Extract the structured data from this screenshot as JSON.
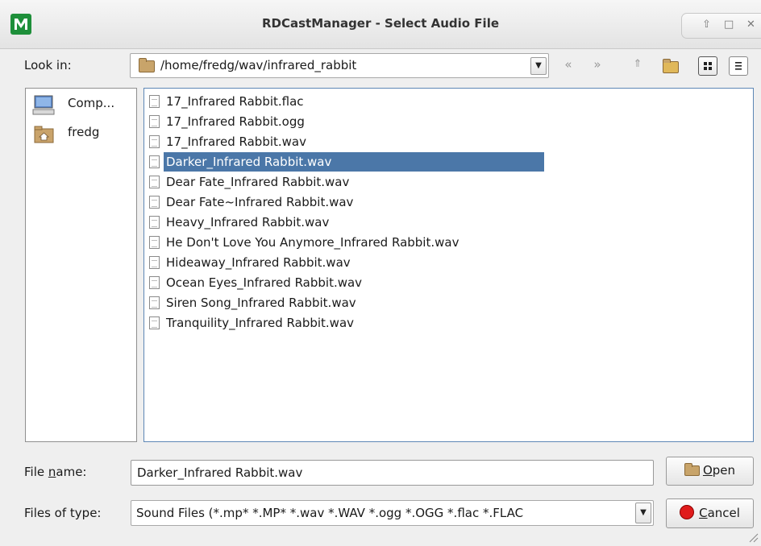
{
  "window": {
    "title": "RDCastManager - Select Audio File",
    "controls": [
      "⇧",
      "□",
      "✕"
    ]
  },
  "look_in": {
    "label": "Look in:",
    "path": "/home/fredg/wav/infrared_rabbit",
    "toolbar_icons": [
      "back-icon",
      "forward-icon",
      "parent-directory-icon",
      "new-folder-icon",
      "list-view-icon",
      "detail-view-icon"
    ]
  },
  "sidebar": {
    "items": [
      {
        "label": "Comp...",
        "icon": "computer-icon"
      },
      {
        "label": "fredg",
        "icon": "home-folder-icon"
      }
    ]
  },
  "files": [
    "17_Infrared Rabbit.flac",
    "17_Infrared Rabbit.ogg",
    "17_Infrared Rabbit.wav",
    "Darker_Infrared Rabbit.wav",
    "Dear Fate_Infrared Rabbit.wav",
    "Dear Fate~Infrared Rabbit.wav",
    "Heavy_Infrared Rabbit.wav",
    "He Don't Love You Anymore_Infrared Rabbit.wav",
    "Hideaway_Infrared Rabbit.wav",
    "Ocean Eyes_Infrared Rabbit.wav",
    "Siren Song_Infrared Rabbit.wav",
    "Tranquility_Infrared Rabbit.wav"
  ],
  "selected_file_index": 3,
  "file_name": {
    "label_pre": "File ",
    "label_mnemonic": "n",
    "label_post": "ame:",
    "value": "Darker_Infrared Rabbit.wav"
  },
  "file_type": {
    "label": "Files of type:",
    "value": "Sound Files (*.mp* *.MP* *.wav *.WAV *.ogg *.OGG *.flac *.FLAC"
  },
  "buttons": {
    "open_mnemonic": "O",
    "open_rest": "pen",
    "cancel_mnemonic": "C",
    "cancel_rest": "ancel"
  },
  "colors": {
    "selection": "#4b77a8",
    "accent_border": "#5d87b5",
    "cancel_icon": "#e01b1b"
  }
}
